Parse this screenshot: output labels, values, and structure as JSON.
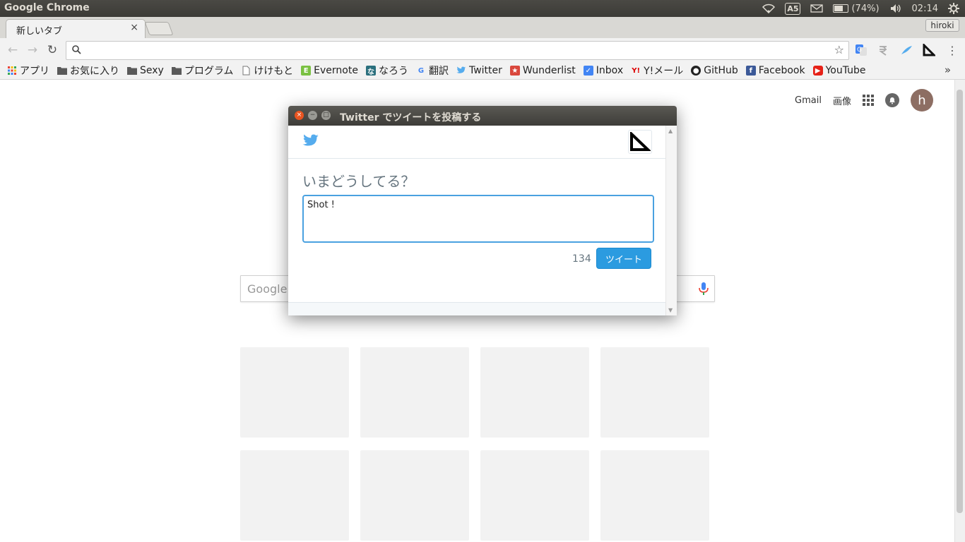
{
  "os": {
    "app_title": "Google Chrome",
    "ime_label": "A5",
    "battery_text": "(74%)",
    "battery_level": 0.74,
    "clock": "02:14"
  },
  "browser": {
    "tab_title": "新しいタブ",
    "tab_close": "×",
    "profile_name": "hiroki",
    "omnibox_value": "",
    "bookmarks": [
      {
        "label": "アプリ",
        "icon": "apps-icon"
      },
      {
        "label": "お気に入り",
        "icon": "folder-icon"
      },
      {
        "label": "Sexy",
        "icon": "folder-icon"
      },
      {
        "label": "プログラム",
        "icon": "folder-icon"
      },
      {
        "label": "けけもと",
        "icon": "page-icon"
      },
      {
        "label": "Evernote",
        "icon": "evernote-icon"
      },
      {
        "label": "なろう",
        "icon": "narou-icon"
      },
      {
        "label": "翻訳",
        "icon": "google-icon"
      },
      {
        "label": "Twitter",
        "icon": "twitter-bird-icon"
      },
      {
        "label": "Wunderlist",
        "icon": "wunderlist-icon"
      },
      {
        "label": "Inbox",
        "icon": "inbox-icon"
      },
      {
        "label": "Y!メール",
        "icon": "yahoo-icon"
      },
      {
        "label": "GitHub",
        "icon": "github-icon"
      },
      {
        "label": "Facebook",
        "icon": "facebook-icon"
      },
      {
        "label": "YouTube",
        "icon": "youtube-icon"
      }
    ],
    "more_bookmarks": "»"
  },
  "newtab": {
    "gmail": "Gmail",
    "images": "画像",
    "avatar_letter": "h",
    "search_placeholder": "Google"
  },
  "popup": {
    "title": "Twitter でツイートを投稿する",
    "question": "いまどうしてる？",
    "tweet_text": "Shot !",
    "char_count": "134",
    "tweet_button": "ツイート"
  },
  "colors": {
    "twitter_blue": "#55acee",
    "tweet_button": "#2b9be0",
    "ubuntu_orange": "#e95420"
  }
}
